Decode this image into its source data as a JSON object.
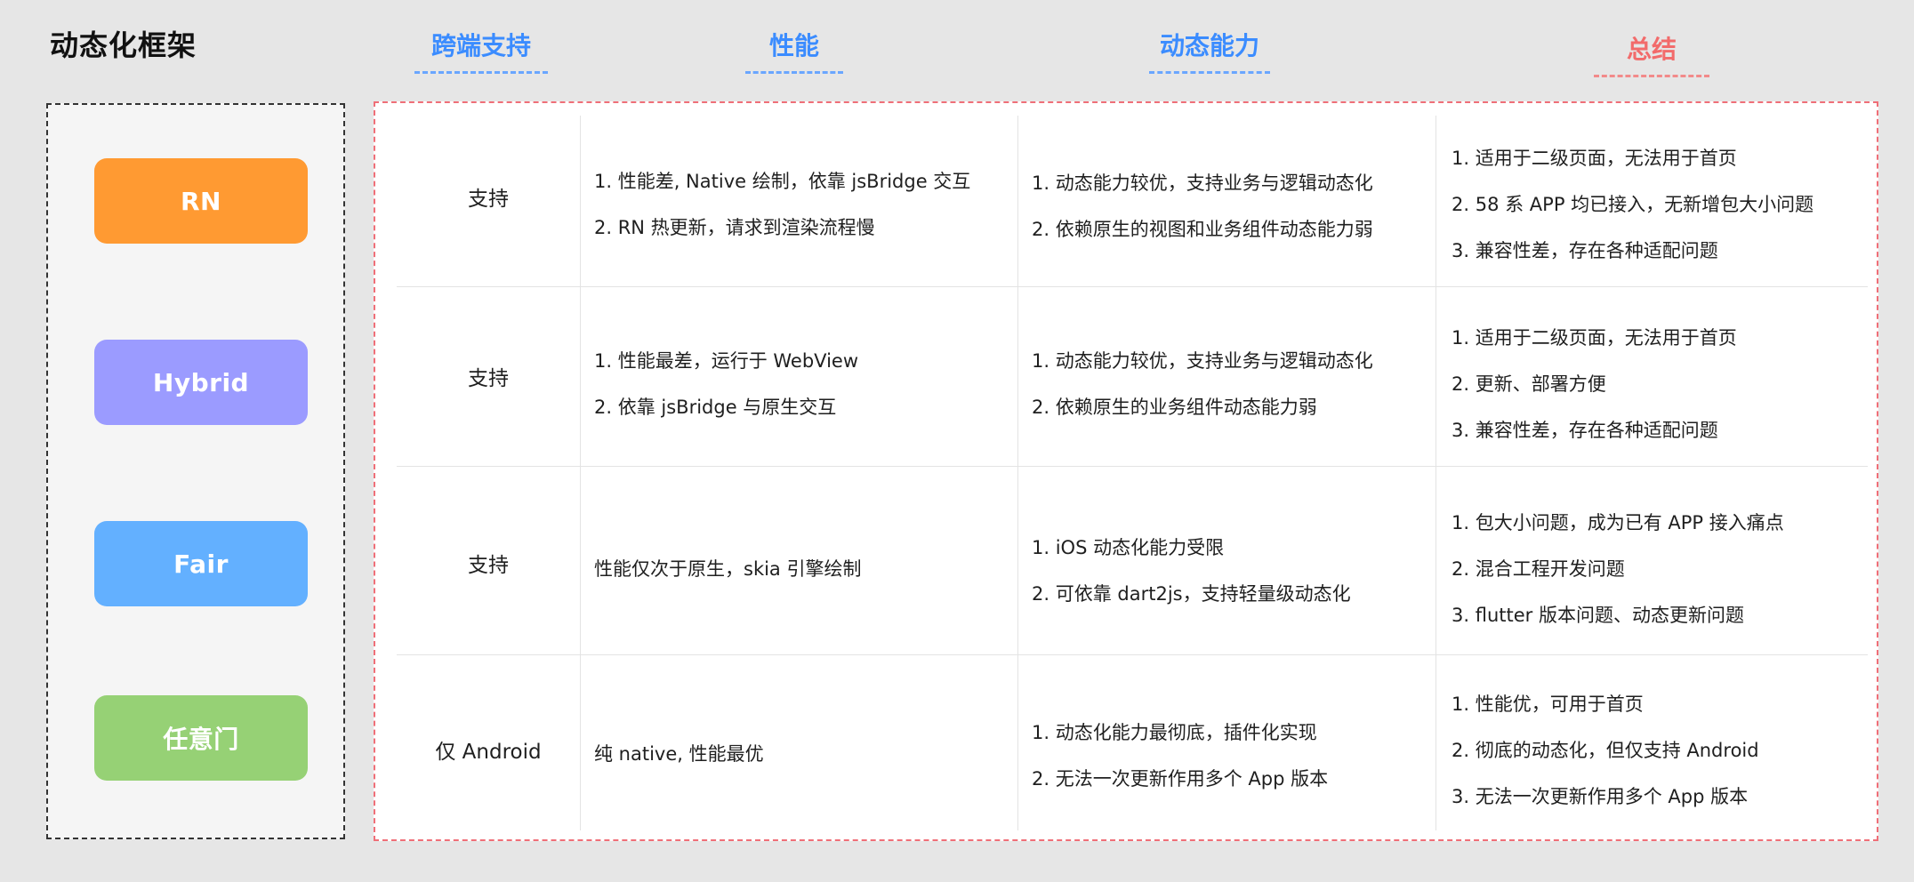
{
  "title": "动态化框架",
  "columns": {
    "cross": "跨端支持",
    "perf": "性能",
    "dynamic": "动态能力",
    "summary": "总结"
  },
  "frameworks": [
    {
      "label": "RN",
      "color": "#ff9a32"
    },
    {
      "label": "Hybrid",
      "color": "#9b9bff"
    },
    {
      "label": "Fair",
      "color": "#63b0ff"
    },
    {
      "label": "任意门",
      "color": "#96d175"
    }
  ],
  "rows": [
    {
      "cross": "支持",
      "perf": [
        "1. 性能差, Native 绘制，依靠 jsBridge 交互",
        "2. RN 热更新，请求到渲染流程慢"
      ],
      "dynamic": [
        "1. 动态能力较优，支持业务与逻辑动态化",
        "2. 依赖原生的视图和业务组件动态能力弱"
      ],
      "summary": [
        "1. 适用于二级页面，无法用于首页",
        "2. 58 系 APP 均已接入，无新增包大小问题",
        "3. 兼容性差，存在各种适配问题"
      ]
    },
    {
      "cross": "支持",
      "perf": [
        "1. 性能最差，运行于 WebView",
        "2. 依靠 jsBridge 与原生交互"
      ],
      "dynamic": [
        "1. 动态能力较优，支持业务与逻辑动态化",
        "2. 依赖原生的业务组件动态能力弱"
      ],
      "summary": [
        "1. 适用于二级页面，无法用于首页",
        "2. 更新、部署方便",
        "3. 兼容性差，存在各种适配问题"
      ]
    },
    {
      "cross": "支持",
      "perf": [
        "性能仅次于原生，skia 引擎绘制"
      ],
      "dynamic": [
        "1. iOS 动态化能力受限",
        "2. 可依靠 dart2js，支持轻量级动态化"
      ],
      "summary": [
        "1. 包大小问题，成为已有 APP 接入痛点",
        "2. 混合工程开发问题",
        "3. flutter 版本问题、动态更新问题"
      ]
    },
    {
      "cross": "仅 Android",
      "perf": [
        "纯 native, 性能最优"
      ],
      "dynamic": [
        "1. 动态化能力最彻底，插件化实现",
        "2. 无法一次更新作用多个 App 版本"
      ],
      "summary": [
        "1. 性能优，可用于首页",
        "2. 彻底的动态化，但仅支持 Android",
        "3. 无法一次更新作用多个 App 版本"
      ]
    }
  ]
}
